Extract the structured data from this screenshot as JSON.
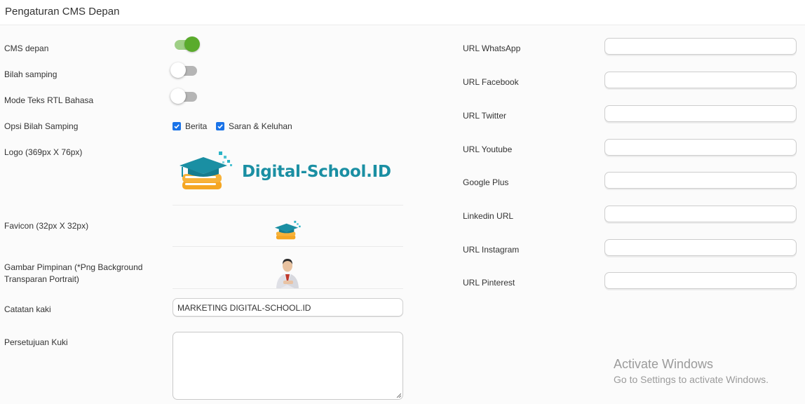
{
  "header": {
    "title": "Pengaturan CMS Depan"
  },
  "left": {
    "cms_depan": {
      "label": "CMS depan",
      "on": true
    },
    "bilah_samping": {
      "label": "Bilah samping",
      "on": false
    },
    "mode_rtl": {
      "label": "Mode Teks RTL Bahasa",
      "on": false
    },
    "opsi_bilah": {
      "label": "Opsi Bilah Samping",
      "options": [
        {
          "label": "Berita",
          "checked": true
        },
        {
          "label": "Saran & Keluhan",
          "checked": true
        }
      ]
    },
    "logo": {
      "label": "Logo (369px X 76px)",
      "brand_text": "Digital-School.ID",
      "brand_color": "#1a8fa3",
      "accent_color": "#f5a623"
    },
    "favicon": {
      "label": "Favicon (32px X 32px)"
    },
    "gambar": {
      "label_line1": "Gambar Pimpinan (*Png Background",
      "label_line2": "Transparan Portrait)"
    },
    "catatan": {
      "label": "Catatan kaki",
      "value": "MARKETING DIGITAL-SCHOOL.ID"
    },
    "kuki": {
      "label": "Persetujuan Kuki",
      "value": ""
    }
  },
  "right": {
    "urls": [
      {
        "label": "URL WhatsApp",
        "value": ""
      },
      {
        "label": "URL Facebook",
        "value": ""
      },
      {
        "label": "URL Twitter",
        "value": ""
      },
      {
        "label": "URL Youtube",
        "value": ""
      },
      {
        "label": "Google Plus",
        "value": ""
      },
      {
        "label": "Linkedin URL",
        "value": ""
      },
      {
        "label": "URL Instagram",
        "value": ""
      },
      {
        "label": "URL Pinterest",
        "value": ""
      }
    ]
  },
  "watermark": {
    "title": "Activate Windows",
    "subtitle": "Go to Settings to activate Windows."
  }
}
